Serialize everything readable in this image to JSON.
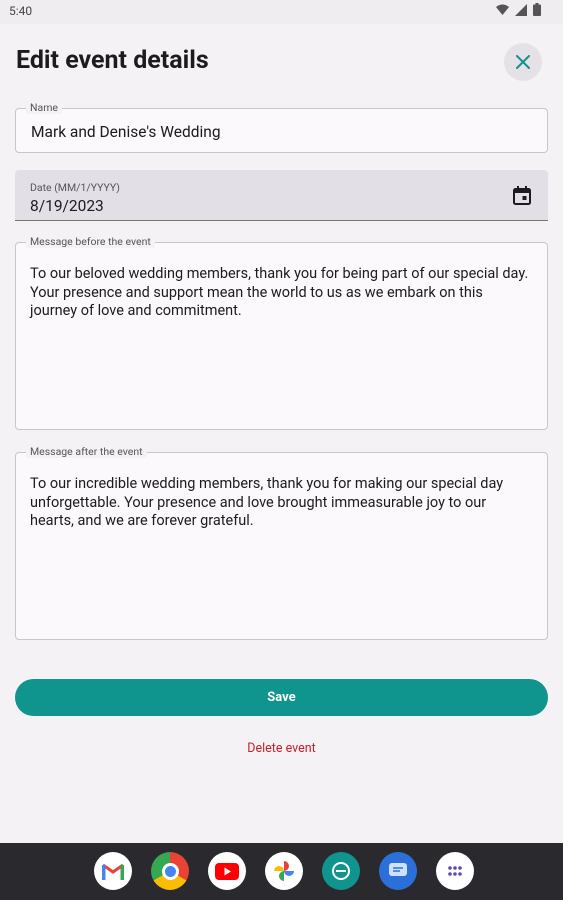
{
  "status_bar": {
    "time": "5:40"
  },
  "header": {
    "title": "Edit event details"
  },
  "form": {
    "name": {
      "label": "Name",
      "value": "Mark and Denise's Wedding"
    },
    "date": {
      "label": "Date (MM/1/YYYY)",
      "value": "8/19/2023"
    },
    "message_before": {
      "label": "Message before the event",
      "value": "To our beloved wedding members, thank you for being part of our special day. Your presence and support mean the world to us as we embark on this journey of love and commitment."
    },
    "message_after": {
      "label": "Message after the event",
      "value": "To our incredible wedding members, thank you for making our special day unforgettable. Your presence and love brought immeasurable joy to our hearts, and we are forever grateful."
    }
  },
  "actions": {
    "save_label": "Save",
    "delete_label": "Delete event"
  },
  "colors": {
    "accent": "#0f948e",
    "danger": "#c6202a",
    "nav_bg": "#2a2a2e"
  },
  "dock": {
    "apps": [
      "gmail-icon",
      "chrome-icon",
      "youtube-icon",
      "photos-icon",
      "messages-app-icon",
      "chat-icon",
      "app-drawer-icon"
    ]
  }
}
